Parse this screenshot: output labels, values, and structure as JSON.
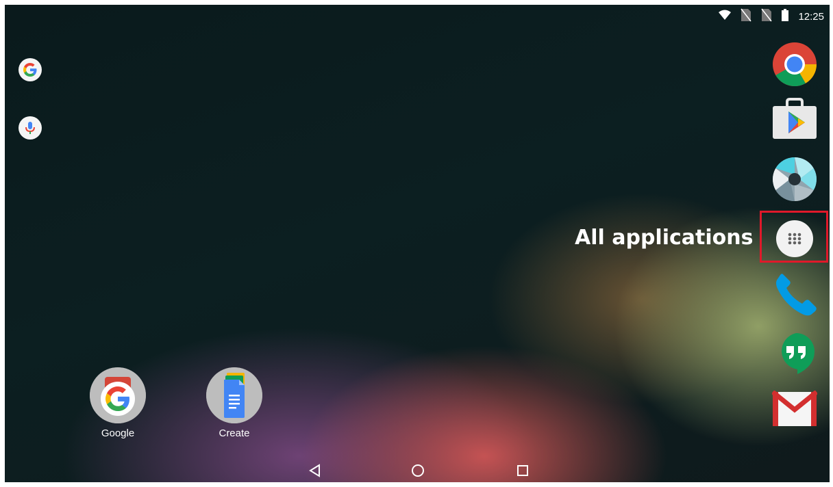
{
  "status_bar": {
    "time": "12:25",
    "icons": [
      "wifi-icon",
      "no-sim-icon",
      "no-sim-icon",
      "battery-icon"
    ]
  },
  "left_widgets": [
    {
      "icon": "google-search-icon"
    },
    {
      "icon": "microphone-icon"
    }
  ],
  "dock": {
    "icons": [
      "chrome-icon",
      "play-store-icon",
      "camera-icon",
      "all-apps-icon",
      "phone-icon",
      "hangouts-icon",
      "gmail-icon"
    ]
  },
  "annotation": {
    "label": "All applications",
    "highlight_color": "#e0192a"
  },
  "desktop_apps": [
    {
      "label": "Google",
      "icon": "google-folder-icon"
    },
    {
      "label": "Create",
      "icon": "docs-create-icon"
    }
  ],
  "nav_bar": {
    "buttons": [
      "back-icon",
      "home-icon",
      "recents-icon"
    ]
  }
}
